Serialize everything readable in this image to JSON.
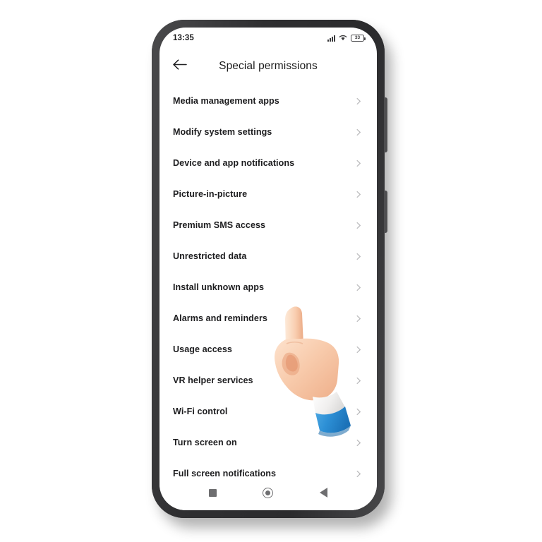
{
  "device": {
    "frame_color": "#3a3a3c",
    "screen_bg": "#ffffff",
    "buttons": [
      {
        "name": "volume-rocker"
      },
      {
        "name": "power-button"
      }
    ]
  },
  "status_bar": {
    "time": "13:35",
    "battery_level": "33",
    "icons": [
      "signal-icon",
      "wifi-icon",
      "battery-icon"
    ]
  },
  "app_bar": {
    "back_icon": "arrow-left-icon",
    "title": "Special permissions"
  },
  "settings_list": {
    "chevron_icon": "chevron-right-icon",
    "chevron_color": "#b9b9bb",
    "items": [
      {
        "label": "Media management apps"
      },
      {
        "label": "Modify system settings"
      },
      {
        "label": "Device and app notifications"
      },
      {
        "label": "Picture-in-picture"
      },
      {
        "label": "Premium SMS access"
      },
      {
        "label": "Unrestricted data"
      },
      {
        "label": "Install unknown apps"
      },
      {
        "label": "Alarms and reminders"
      },
      {
        "label": "Usage access"
      },
      {
        "label": "VR helper services"
      },
      {
        "label": "Wi-Fi control"
      },
      {
        "label": "Turn screen on"
      },
      {
        "label": "Full screen notifications"
      }
    ]
  },
  "nav_bar": {
    "buttons": [
      {
        "name": "recents-button",
        "icon": "square-icon"
      },
      {
        "name": "home-button",
        "icon": "circle-icon"
      },
      {
        "name": "back-button",
        "icon": "triangle-left-icon"
      }
    ],
    "icon_color": "#6e6e70"
  },
  "cursor": {
    "type": "pointing-hand-3d",
    "skin_color": "#f7cba8",
    "skin_shadow": "#e8a882",
    "sleeve_color": "#2f93d8",
    "sleeve_shadow": "#1d76bc",
    "cuff_color": "#f2f2f2",
    "points_at": "Alarms and reminders"
  }
}
